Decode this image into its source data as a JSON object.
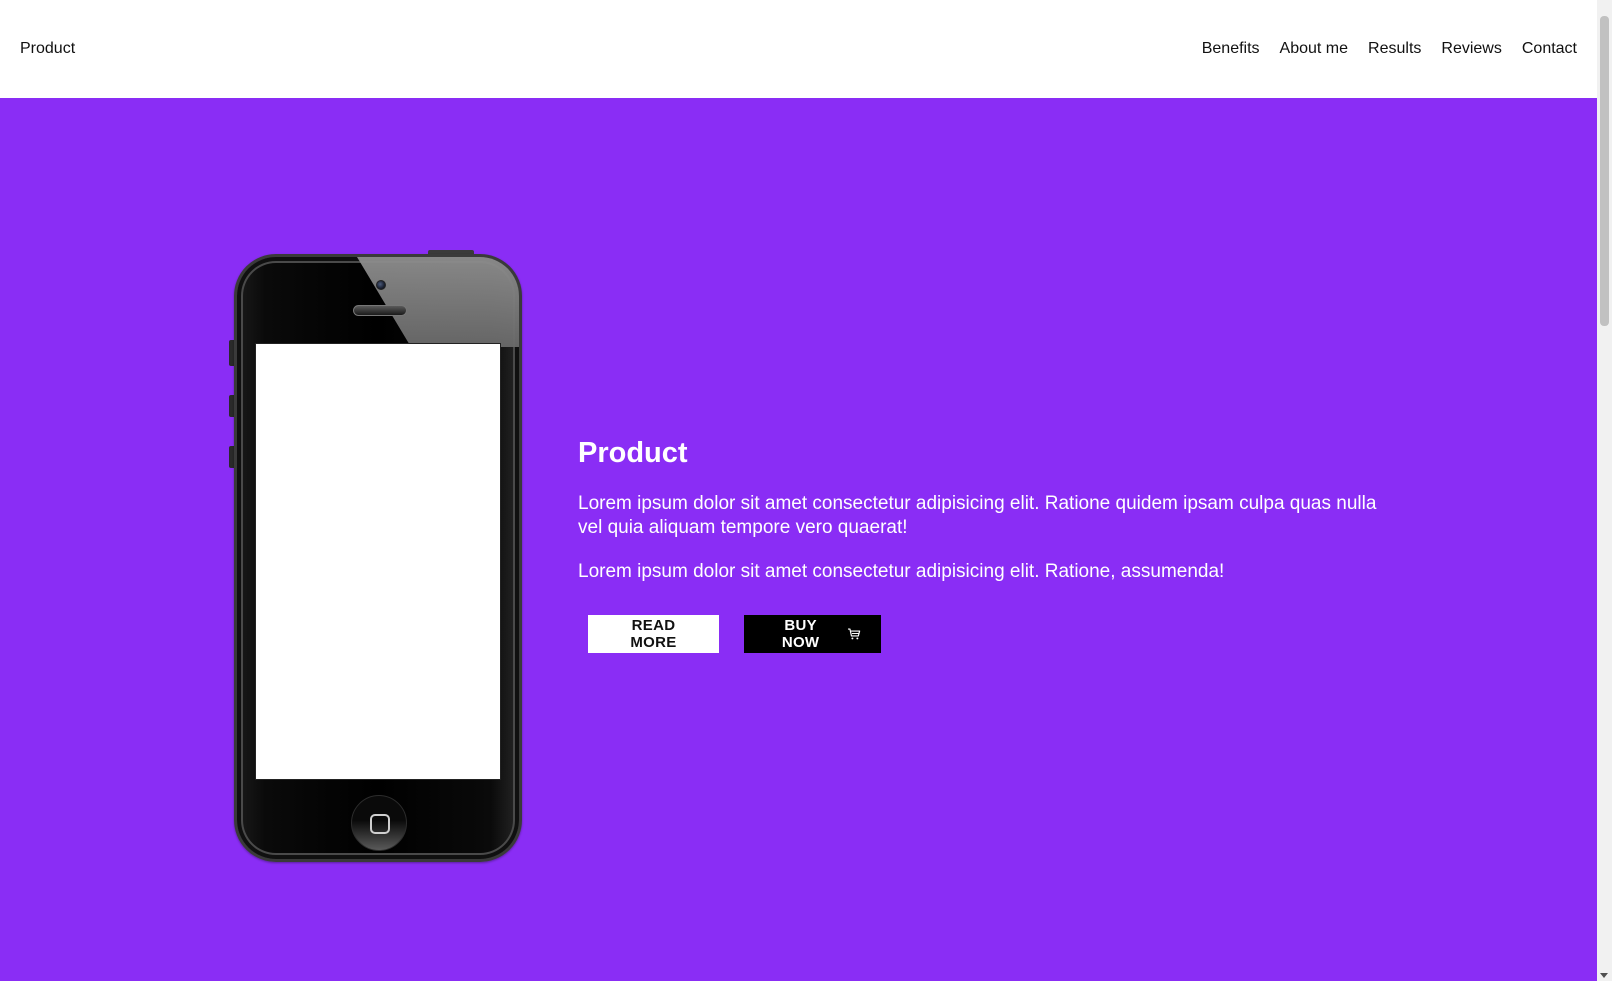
{
  "header": {
    "brand": "Product",
    "nav": [
      {
        "label": "Benefits"
      },
      {
        "label": "About me"
      },
      {
        "label": "Results"
      },
      {
        "label": "Reviews"
      },
      {
        "label": "Contact"
      }
    ]
  },
  "hero": {
    "title": "Product",
    "paragraph_1": "Lorem ipsum dolor sit amet consectetur adipisicing elit. Ratione quidem ipsam culpa quas nulla vel quia aliquam tempore vero quaerat!",
    "paragraph_2": "Lorem ipsum dolor sit amet consectetur adipisicing elit. Ratione, assumenda!",
    "read_more_label": "READ MORE",
    "buy_now_label": "BUY NOW",
    "buy_now_icon": "cart-icon"
  },
  "colors": {
    "hero_background": "#8a2df5",
    "header_background": "#ffffff",
    "primary_button": "#000000",
    "secondary_button": "#ffffff"
  }
}
